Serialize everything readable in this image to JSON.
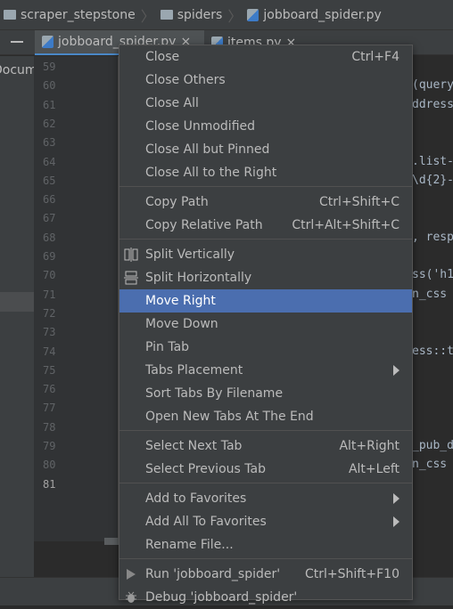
{
  "breadcrumb": [
    "scraper_stepstone",
    "spiders",
    "jobboard_spider.py"
  ],
  "tabs": [
    {
      "label": "jobboard_spider.py"
    },
    {
      "label": "items.py"
    }
  ],
  "left_panel": {
    "text": "Documents"
  },
  "line_numbers": [
    "59",
    "60",
    "61",
    "62",
    "63",
    "64",
    "65",
    "66",
    "67",
    "68",
    "69",
    "70",
    "71",
    "72",
    "73",
    "74",
    "75",
    "76",
    "77",
    "78",
    "79",
    "80",
    "81"
  ],
  "code_fragments": [
    {
      "line": "60",
      "text": "(query"
    },
    {
      "line": "61",
      "text": "ddress"
    },
    {
      "line": "64",
      "text": ".list-"
    },
    {
      "line": "65",
      "text": "\\d{2}-"
    },
    {
      "line": "68",
      "text": ", resp"
    },
    {
      "line": "70",
      "text": "ss('h1"
    },
    {
      "line": "71",
      "text": "n_css"
    },
    {
      "line": "74",
      "text": "ess::t"
    },
    {
      "line": "79",
      "text": "_pub_d"
    },
    {
      "line": "80",
      "text": "n_css"
    }
  ],
  "menu": {
    "groups": [
      [
        {
          "label": "Close",
          "shortcut": "Ctrl+F4"
        },
        {
          "label": "Close Others"
        },
        {
          "label": "Close All"
        },
        {
          "label": "Close Unmodified"
        },
        {
          "label": "Close All but Pinned"
        },
        {
          "label": "Close All to the Right"
        }
      ],
      [
        {
          "label": "Copy Path",
          "shortcut": "Ctrl+Shift+C"
        },
        {
          "label": "Copy Relative Path",
          "shortcut": "Ctrl+Alt+Shift+C"
        }
      ],
      [
        {
          "label": "Split Vertically",
          "icon": "split-vertical-icon"
        },
        {
          "label": "Split Horizontally",
          "icon": "split-horizontal-icon"
        },
        {
          "label": "Move Right",
          "highlighted": true
        },
        {
          "label": "Move Down"
        },
        {
          "label": "Pin Tab"
        },
        {
          "label": "Tabs Placement",
          "submenu": true
        },
        {
          "label": "Sort Tabs By Filename"
        },
        {
          "label": "Open New Tabs At The End"
        }
      ],
      [
        {
          "label": "Select Next Tab",
          "shortcut": "Alt+Right"
        },
        {
          "label": "Select Previous Tab",
          "shortcut": "Alt+Left"
        }
      ],
      [
        {
          "label": "Add to Favorites",
          "submenu": true
        },
        {
          "label": "Add All To Favorites",
          "submenu": true
        },
        {
          "label": "Rename File..."
        }
      ],
      [
        {
          "label": "Run 'jobboard_spider'",
          "shortcut": "Ctrl+Shift+F10",
          "icon": "run-icon"
        },
        {
          "label": "Debug 'jobboard_spider'",
          "icon": "debug-icon"
        }
      ]
    ]
  },
  "colors": {
    "highlight": "#4b6eaf",
    "menu_bg": "#3c3f41",
    "editor_bg": "#2b2b2b"
  }
}
